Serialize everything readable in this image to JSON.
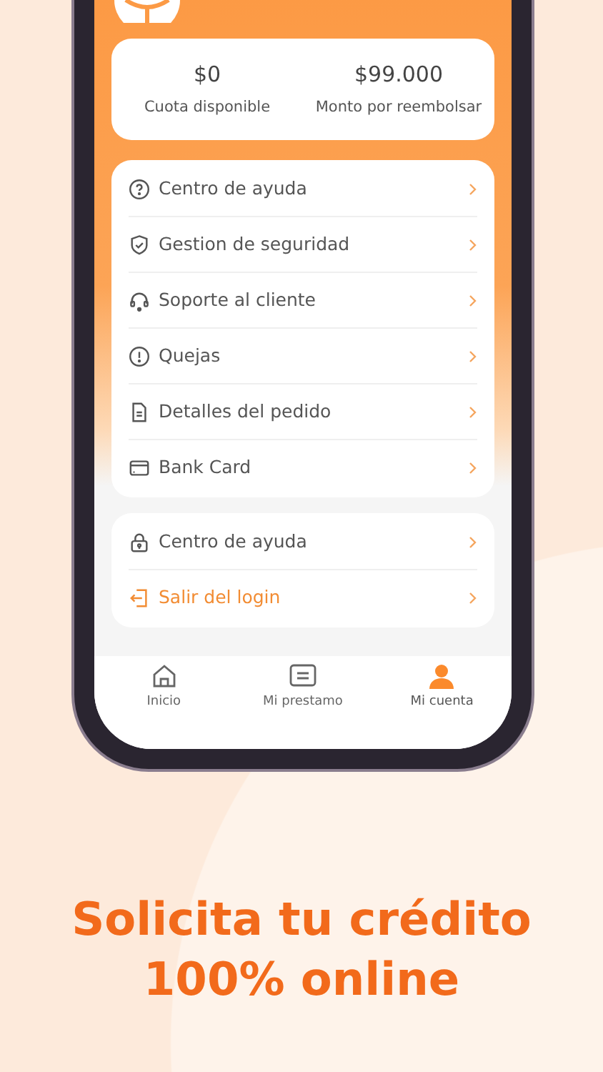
{
  "summary": [
    {
      "value": "$0",
      "label": "Cuota disponible"
    },
    {
      "value": "$99.000",
      "label": "Monto por reembolsar"
    }
  ],
  "menu": [
    {
      "label": "Centro de ayuda",
      "kind": "normal"
    },
    {
      "label": "Gestion de seguridad",
      "kind": "normal"
    },
    {
      "label": "Soporte al cliente",
      "kind": "normal"
    },
    {
      "label": "Quejas",
      "kind": "normal"
    },
    {
      "label": "Detalles del pedido",
      "kind": "normal"
    },
    {
      "label": "Bank Card",
      "kind": "normal"
    }
  ],
  "menu_2": [
    {
      "label": "Centro de ayuda",
      "kind": "normal"
    },
    {
      "label": "Salir del login",
      "kind": "logout"
    }
  ],
  "tab_bar": [
    {
      "label": "Inicio",
      "selected": false
    },
    {
      "label": "Mi prestamo",
      "selected": false
    },
    {
      "label": "Mi cuenta",
      "selected": true
    }
  ],
  "headline": [
    "Solicita tu crédito",
    "100% online"
  ]
}
